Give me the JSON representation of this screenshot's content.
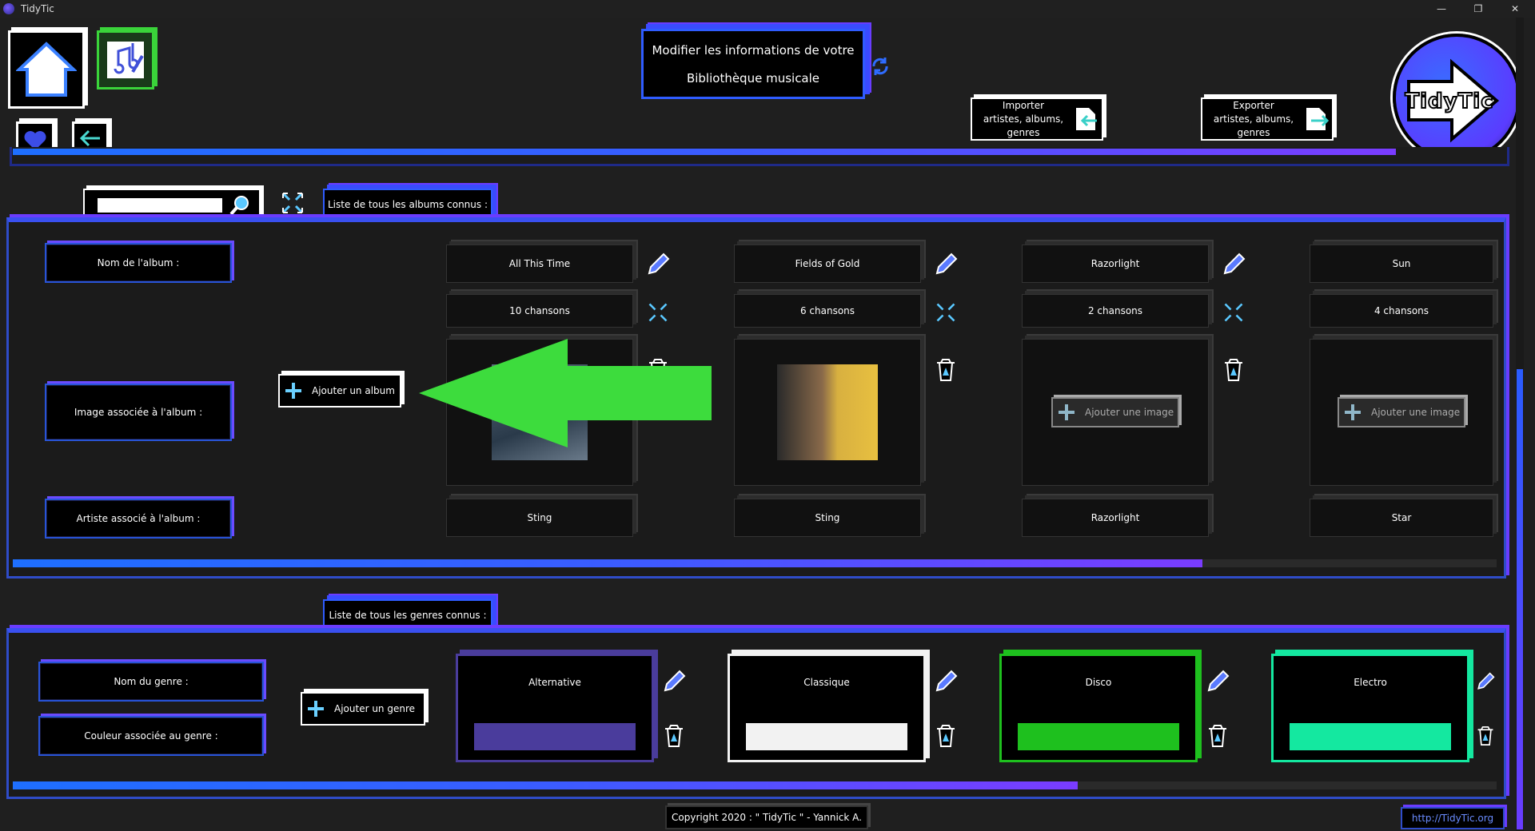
{
  "window": {
    "title": "TidyTic",
    "min": "—",
    "max": "❐",
    "close": "✕"
  },
  "header": {
    "title_line1": "Modifier les informations de votre",
    "title_line2": "Bibliothèque musicale",
    "import_label": "Importer artistes, albums, genres",
    "export_label": "Exporter artistes, albums, genres",
    "logo_text": "TidyTic"
  },
  "albums": {
    "tab_label": "Liste de tous les albums connus :",
    "search_value": "",
    "row_labels": {
      "name": "Nom de l'album :",
      "image": "Image associée à l'album :",
      "artist": "Artiste associé à l'album :"
    },
    "add_album_label": "Ajouter un album",
    "add_image_label": "Ajouter une image",
    "items": [
      {
        "name": "All This Time",
        "songs": "10 chansons",
        "artist": "Sting",
        "has_image": true
      },
      {
        "name": "Fields of Gold",
        "songs": "6 chansons",
        "artist": "Sting",
        "has_image": true
      },
      {
        "name": "Razorlight",
        "songs": "2 chansons",
        "artist": "Razorlight",
        "has_image": false
      },
      {
        "name": "Sun",
        "songs": "4 chansons",
        "artist": "Star",
        "has_image": false
      }
    ]
  },
  "genres": {
    "tab_label": "Liste de tous les genres connus :",
    "row_labels": {
      "name": "Nom du genre :",
      "color": "Couleur associée au genre :"
    },
    "add_genre_label": "Ajouter un genre",
    "items": [
      {
        "name": "Alternative",
        "color": "#4a3c9c"
      },
      {
        "name": "Classique",
        "color": "#f2f2f2"
      },
      {
        "name": "Disco",
        "color": "#1ec01e"
      },
      {
        "name": "Electro",
        "color": "#14e8a0"
      }
    ]
  },
  "footer": {
    "copyright": "Copyright 2020 : \" TidyTic \" - Yannick A.",
    "link": "http://TidyTic.org"
  },
  "colors": {
    "accent_blue": "#2f5cff",
    "accent_purple": "#7a3cff",
    "arrow_green": "#3ddc3d"
  }
}
